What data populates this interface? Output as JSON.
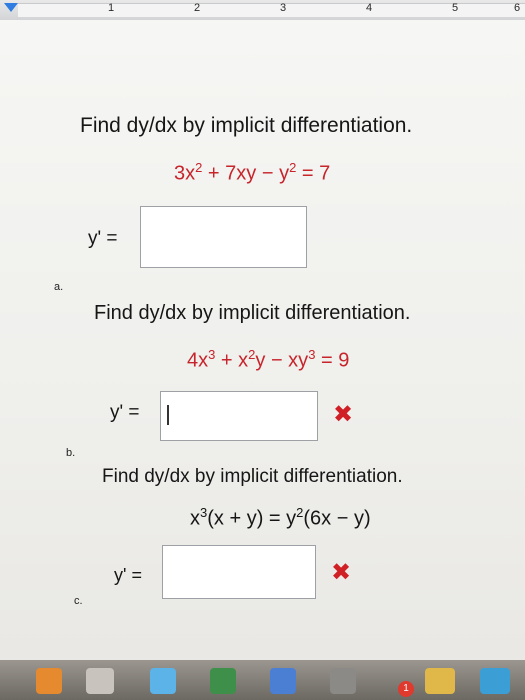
{
  "ruler": {
    "numbers": [
      "1",
      "2",
      "3",
      "4",
      "5",
      "6"
    ]
  },
  "problems": [
    {
      "part": "a.",
      "instruction": "Find dy/dx by implicit differentiation.",
      "equation": {
        "pre": "3x",
        "exp1": "2",
        "mid": " + 7xy − y",
        "exp2": "2",
        "post": " = 7"
      },
      "answer_label": "y' =",
      "answer_value": "",
      "status": null
    },
    {
      "part": "b.",
      "instruction": "Find dy/dx by implicit differentiation.",
      "equation": {
        "pre": "4x",
        "exp1": "3",
        "mid": " + x",
        "exp2": "2",
        "mid2": "y − xy",
        "exp3": "3",
        "post": " = 9"
      },
      "answer_label": "y' =",
      "answer_value": "",
      "status": "incorrect"
    },
    {
      "part": "c.",
      "instruction": "Find dy/dx by implicit differentiation.",
      "equation": {
        "pre": "x",
        "exp1": "3",
        "mid": "(x + y) = y",
        "exp2": "2",
        "post": "(6x − y)"
      },
      "answer_label": "y' =",
      "answer_value": "",
      "status": "incorrect"
    }
  ],
  "dock": {
    "badge_count": "1"
  },
  "colors": {
    "equation": "#c7242b",
    "incorrect": "#d01f25",
    "ruler_tab": "#2f7de0"
  }
}
